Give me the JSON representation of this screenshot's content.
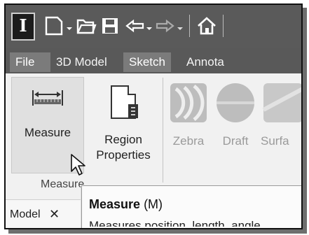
{
  "app": {
    "logo_letter": "I"
  },
  "quick_access": {
    "icons": [
      "new-file-icon",
      "open-folder-icon",
      "save-icon",
      "undo-icon",
      "redo-icon",
      "home-icon"
    ]
  },
  "tabs": [
    {
      "label": "File",
      "active": true
    },
    {
      "label": "3D Model",
      "active": false
    },
    {
      "label": "Sketch",
      "active": true
    },
    {
      "label": "Annota",
      "active": false
    }
  ],
  "ribbon": {
    "measure": {
      "label": "Measure"
    },
    "region_properties": {
      "line1": "Region",
      "line2": "Properties"
    },
    "zebra": {
      "label": "Zebra"
    },
    "draft": {
      "label": "Draft"
    },
    "surface": {
      "label": "Surfa"
    },
    "group_label": "Measure"
  },
  "document_tab": {
    "label": "Model",
    "close": "✕"
  },
  "tooltip": {
    "title": "Measure",
    "shortcut": "(M)",
    "description": "Measures position, length, angle"
  },
  "colors": {
    "title_bar": "#5a5a5a",
    "active_tab": "#7b7b7b",
    "panel": "#f1f1f1"
  }
}
